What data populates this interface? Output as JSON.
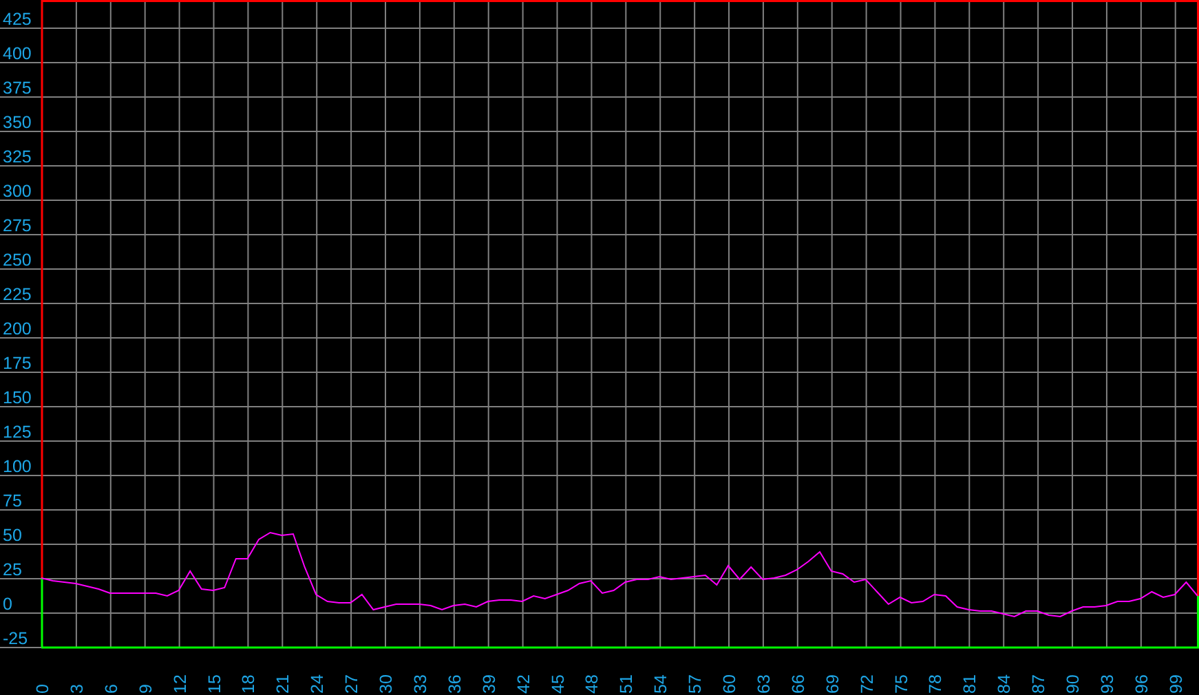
{
  "chart_data": {
    "type": "line",
    "x": [
      0,
      1,
      2,
      3,
      4,
      5,
      6,
      7,
      8,
      9,
      10,
      11,
      12,
      13,
      14,
      15,
      16,
      17,
      18,
      19,
      20,
      21,
      22,
      23,
      24,
      25,
      26,
      27,
      28,
      29,
      30,
      31,
      32,
      33,
      34,
      35,
      36,
      37,
      38,
      39,
      40,
      41,
      42,
      43,
      44,
      45,
      46,
      47,
      48,
      49,
      50,
      51,
      52,
      53,
      54,
      55,
      56,
      57,
      58,
      59,
      60,
      61,
      62,
      63,
      64,
      65,
      66,
      67,
      68,
      69,
      70,
      71,
      72,
      73,
      74,
      75,
      76,
      77,
      78,
      79,
      80,
      81,
      82,
      83,
      84,
      85,
      86,
      87,
      88,
      89,
      90,
      91,
      92,
      93,
      94,
      95,
      96,
      97,
      98,
      99,
      100,
      101
    ],
    "grid": true,
    "series": [
      {
        "color": "#ff00ff",
        "values": [
          25,
          23,
          22,
          21,
          19,
          17,
          14,
          14,
          14,
          14,
          14,
          12,
          16,
          30,
          17,
          16,
          18,
          39,
          39,
          53,
          58,
          56,
          57,
          33,
          13,
          8,
          7,
          7,
          13,
          2,
          4,
          6,
          6,
          6,
          5,
          2,
          5,
          6,
          4,
          8,
          9,
          9,
          8,
          12,
          10,
          13,
          16,
          21,
          23,
          14,
          16,
          22,
          24,
          24,
          26,
          24,
          25,
          26,
          27,
          20,
          34,
          24,
          33,
          24,
          25,
          27,
          31,
          37,
          44,
          30,
          28,
          22,
          24,
          15,
          6,
          11,
          7,
          8,
          13,
          12,
          4,
          2,
          1,
          1,
          -1,
          -3,
          1,
          1,
          -2,
          -3,
          1,
          4,
          4,
          5,
          8,
          8,
          10,
          15,
          11,
          13,
          22,
          12
        ]
      }
    ],
    "xlim": [
      0,
      101
    ],
    "ylim": [
      -25,
      445
    ],
    "xticks": [
      0,
      3,
      6,
      9,
      12,
      15,
      18,
      21,
      24,
      27,
      30,
      33,
      36,
      39,
      42,
      45,
      48,
      51,
      54,
      57,
      60,
      63,
      66,
      69,
      72,
      75,
      78,
      81,
      84,
      87,
      90,
      93,
      96,
      99
    ],
    "yticks": [
      -25,
      0,
      25,
      50,
      75,
      100,
      125,
      150,
      175,
      200,
      225,
      250,
      275,
      300,
      325,
      350,
      375,
      400,
      425
    ]
  }
}
